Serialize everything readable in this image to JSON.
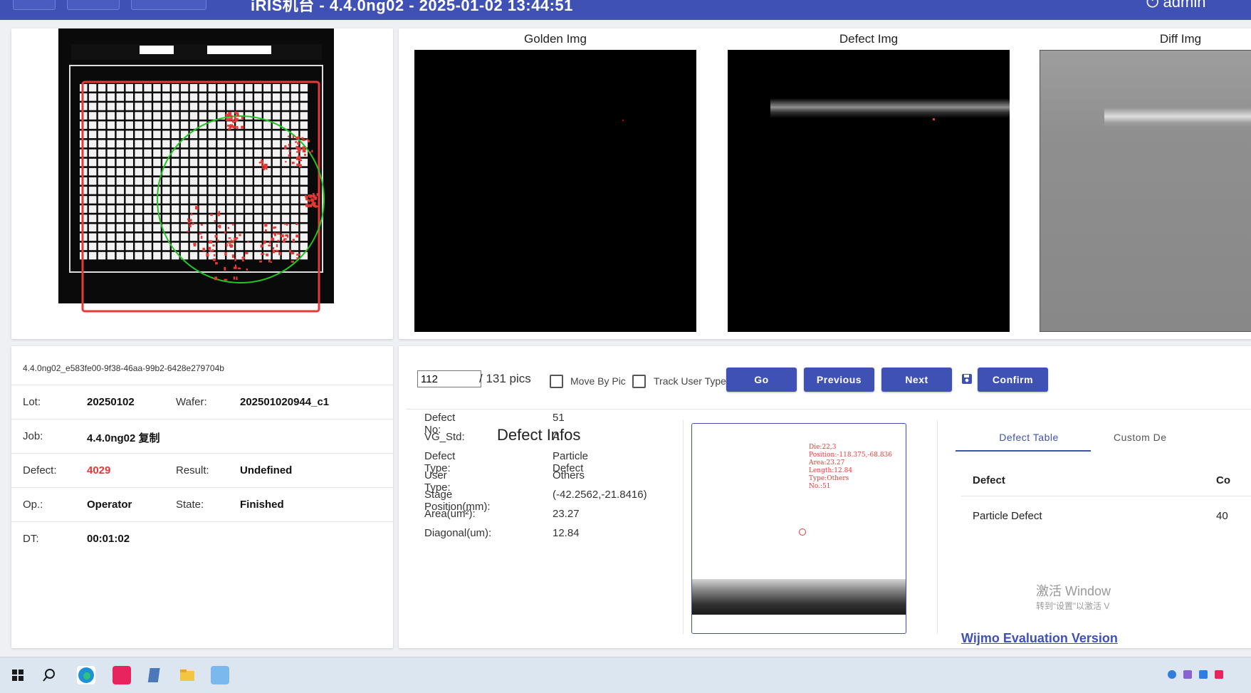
{
  "header": {
    "title": "iRIS机台 - 4.4.0ng02 - 2025-01-02 13:44:51",
    "user": "admin",
    "user_icon": "power-icon"
  },
  "images": {
    "golden_title": "Golden Img",
    "defect_title": "Defect Img",
    "diff_title": "Diff Img"
  },
  "info": {
    "id": "4.4.0ng02_e583fe00-9f38-46aa-99b2-6428e279704b",
    "lot_label": "Lot:",
    "lot": "20250102",
    "wafer_label": "Wafer:",
    "wafer": "202501020944_c1",
    "job_label": "Job:",
    "job": "4.4.0ng02 复制",
    "defect_label": "Defect:",
    "defect": "4029",
    "result_label": "Result:",
    "result": "Undefined",
    "op_label": "Op.:",
    "op": "Operator",
    "state_label": "State:",
    "state": "Finished",
    "dt_label": "DT:",
    "dt": "00:01:02"
  },
  "controls": {
    "page_value": "112",
    "total": "/ 131 pics",
    "move_by_pic": "Move By Pic",
    "track_user_type": "Track User Type",
    "go": "Go",
    "previous": "Previous",
    "next": "Next",
    "save_icon": "save-icon",
    "confirm": "Confirm"
  },
  "defect_infos": {
    "title": "Defect Infos",
    "rows": [
      {
        "label": "Defect No:",
        "value": "51"
      },
      {
        "label": "VG_Std:",
        "value": "A"
      },
      {
        "label": "Defect Type:",
        "value": "Particle Defect"
      },
      {
        "label": "User Type:",
        "value": "Others"
      },
      {
        "label": "Stage Position(mm):",
        "value": "(-42.2562,-21.8416)"
      },
      {
        "label": "Area(um²):",
        "value": "23.27"
      },
      {
        "label": "Diagonal(um):",
        "value": "12.84"
      }
    ]
  },
  "thumb_text": [
    "Die:22,3",
    "Position:-118.375,-68.836",
    "Area:23.27",
    "Length:12.84",
    "Type:Others",
    "No.:51"
  ],
  "tabs": {
    "tab1": "Defect Table",
    "tab2": "Custom De",
    "col1": "Defect",
    "col2": "Co",
    "row_defect": "Particle Defect",
    "row_count": "40"
  },
  "watermark": {
    "line1": "激活 Window",
    "line2": "转到“设置”以激活 V",
    "wijmo": "Wijmo Evaluation Version"
  },
  "colors": {
    "primary": "#3f51b5",
    "defect_red": "#e53935"
  }
}
